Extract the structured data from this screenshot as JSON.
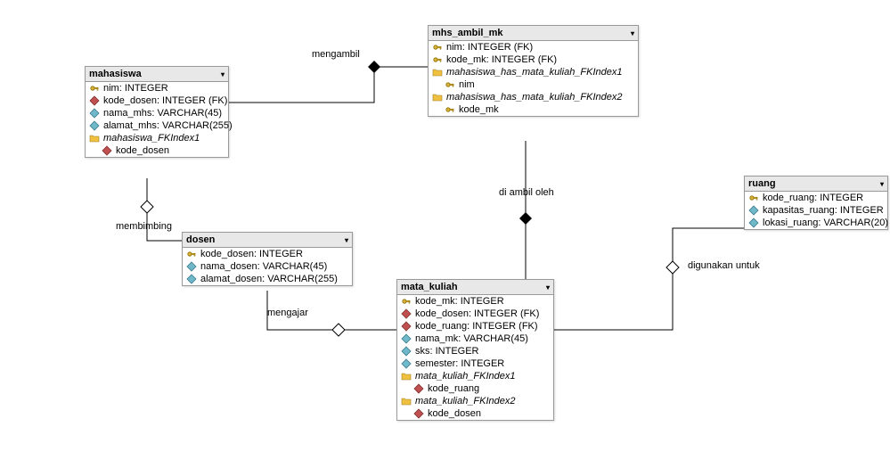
{
  "entities": {
    "mahasiswa": {
      "title": "mahasiswa",
      "fields": [
        {
          "name": "nim: INTEGER",
          "icon": "key"
        },
        {
          "name": "kode_dosen: INTEGER (FK)",
          "icon": "fk"
        },
        {
          "name": "nama_mhs: VARCHAR(45)",
          "icon": "col"
        },
        {
          "name": "alamat_mhs: VARCHAR(255)",
          "icon": "col"
        }
      ],
      "indexes": [
        {
          "name": "mahasiswa_FKIndex1",
          "subs": [
            {
              "name": "kode_dosen",
              "icon": "fk"
            }
          ]
        }
      ]
    },
    "mhs_ambil_mk": {
      "title": "mhs_ambil_mk",
      "fields": [
        {
          "name": "nim: INTEGER (FK)",
          "icon": "key"
        },
        {
          "name": "kode_mk: INTEGER (FK)",
          "icon": "key"
        }
      ],
      "indexes": [
        {
          "name": "mahasiswa_has_mata_kuliah_FKIndex1",
          "subs": [
            {
              "name": "nim",
              "icon": "key"
            }
          ]
        },
        {
          "name": "mahasiswa_has_mata_kuliah_FKIndex2",
          "subs": [
            {
              "name": "kode_mk",
              "icon": "key"
            }
          ]
        }
      ]
    },
    "dosen": {
      "title": "dosen",
      "fields": [
        {
          "name": "kode_dosen: INTEGER",
          "icon": "key"
        },
        {
          "name": "nama_dosen: VARCHAR(45)",
          "icon": "col"
        },
        {
          "name": "alamat_dosen: VARCHAR(255)",
          "icon": "col"
        }
      ],
      "indexes": []
    },
    "mata_kuliah": {
      "title": "mata_kuliah",
      "fields": [
        {
          "name": "kode_mk: INTEGER",
          "icon": "key"
        },
        {
          "name": "kode_dosen: INTEGER (FK)",
          "icon": "fk"
        },
        {
          "name": "kode_ruang: INTEGER (FK)",
          "icon": "fk"
        },
        {
          "name": "nama_mk: VARCHAR(45)",
          "icon": "col"
        },
        {
          "name": "sks: INTEGER",
          "icon": "col"
        },
        {
          "name": "semester: INTEGER",
          "icon": "col"
        }
      ],
      "indexes": [
        {
          "name": "mata_kuliah_FKIndex1",
          "subs": [
            {
              "name": "kode_ruang",
              "icon": "fk"
            }
          ]
        },
        {
          "name": "mata_kuliah_FKIndex2",
          "subs": [
            {
              "name": "kode_dosen",
              "icon": "fk"
            }
          ]
        }
      ]
    },
    "ruang": {
      "title": "ruang",
      "fields": [
        {
          "name": "kode_ruang: INTEGER",
          "icon": "key"
        },
        {
          "name": "kapasitas_ruang: INTEGER",
          "icon": "col"
        },
        {
          "name": "lokasi_ruang: VARCHAR(20)",
          "icon": "col"
        }
      ],
      "indexes": []
    }
  },
  "labels": {
    "mengambil": "mengambil",
    "membimbing": "membimbing",
    "mengajar": "mengajar",
    "diambil": "di ambil oleh",
    "digunakan": "digunakan untuk"
  }
}
